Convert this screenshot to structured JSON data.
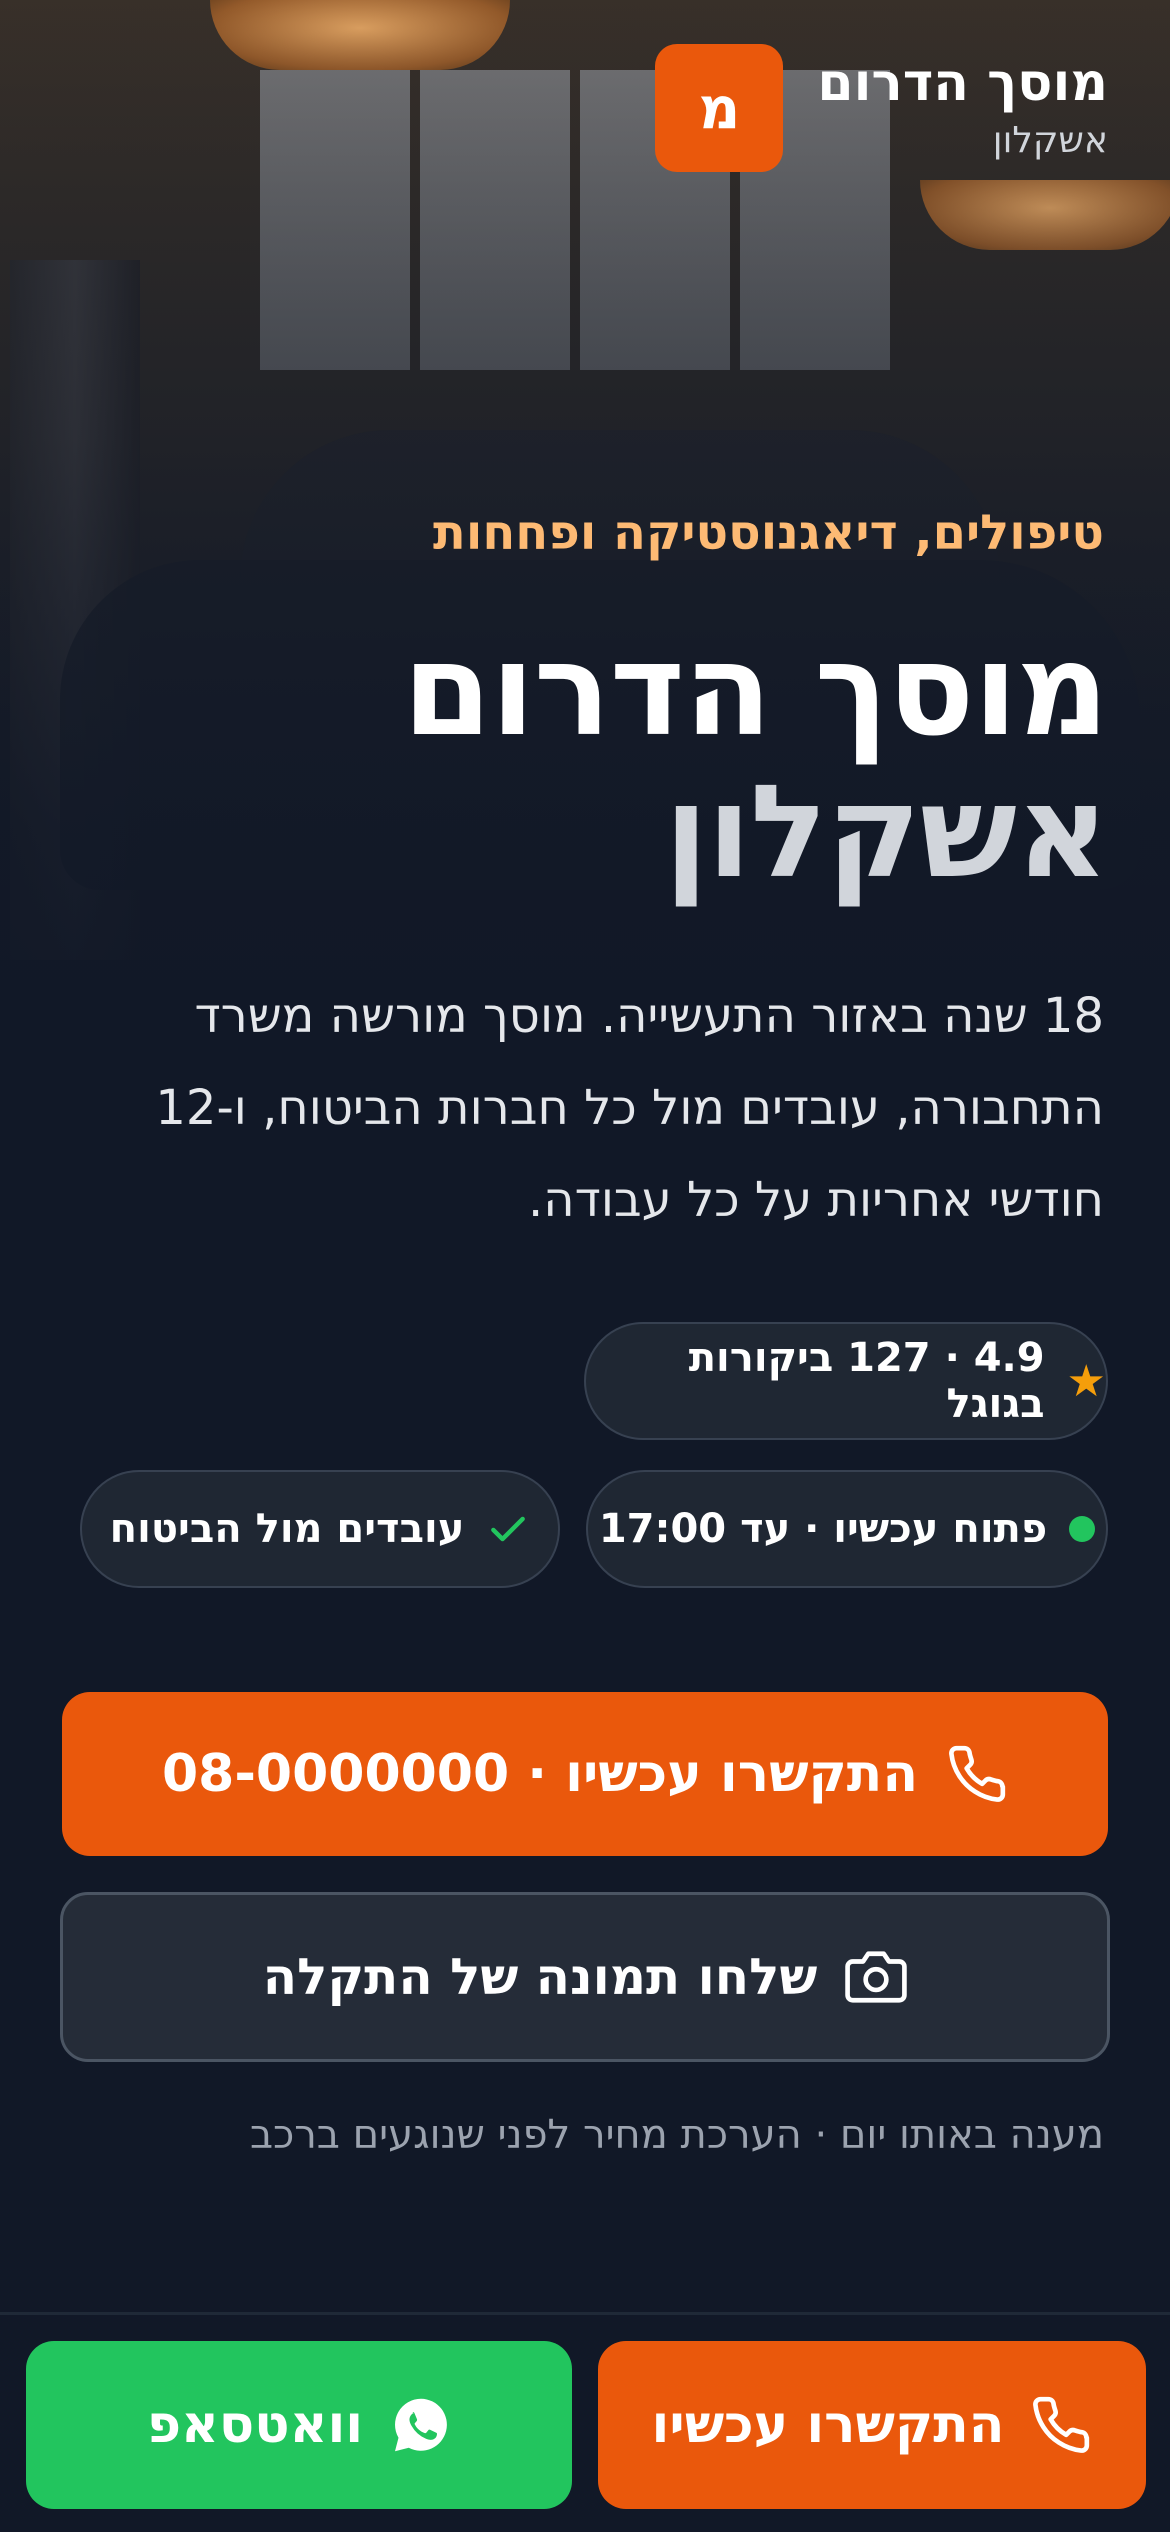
{
  "brand": {
    "badge_letter": "מ",
    "name": "מוסך הדרום",
    "city": "אשקלון"
  },
  "hero": {
    "eyebrow": "טיפולים, דיאגנוסטיקה ופחחות",
    "headline_line1": "מוסך הדרום",
    "headline_line2": "אשקלון",
    "description": "18 שנה באזור התעשייה. מוסך מורשה משרד התחבורה, עובדים מול כל חברות הביטוח, ו-12 חודשי אחריות על כל עבודה."
  },
  "badges": {
    "rating_text": "4.9 · 127 ביקורות בגוגל",
    "open_text": "פתוח עכשיו · עד 17:00",
    "insurance_text": "עובדים מול הביטוח"
  },
  "actions": {
    "call_label": "התקשרו עכשיו · 08-0000000",
    "photo_label": "שלחו תמונה של התקלה",
    "note": "מענה באותו יום · הערכת מחיר לפני שנוגעים ברכב"
  },
  "bottom_bar": {
    "call_label": "התקשרו עכשיו",
    "whatsapp_label": "וואטסאפ"
  },
  "colors": {
    "accent": "#ea580c",
    "whatsapp": "#22c55e",
    "background": "#111827",
    "eyebrow": "#fdba74",
    "star": "#f59e0b"
  },
  "icons": {
    "phone": "phone-icon",
    "camera": "camera-icon",
    "whatsapp": "whatsapp-icon",
    "star": "star-icon",
    "check": "check-icon",
    "status_dot": "status-dot-icon"
  }
}
